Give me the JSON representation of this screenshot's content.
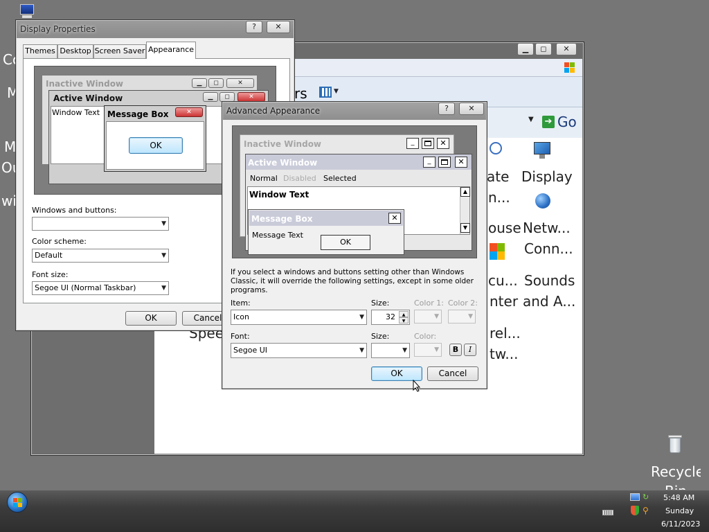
{
  "desktop": {
    "left_labels": [
      "Co",
      "M",
      "M",
      "Ou",
      "wi"
    ],
    "recycle_bin_label": "Recycle Bin"
  },
  "control_panel": {
    "toolbar_view_text": "rs",
    "go_label": "Go",
    "icons": [
      {
        "lines": [
          "ate",
          "n..."
        ],
        "icon": "update-icon"
      },
      {
        "lines": [
          "Display"
        ],
        "icon": "display-icon"
      },
      {
        "lines": [
          "ouse"
        ],
        "icon": "mouse-icon"
      },
      {
        "lines": [
          "Netw...",
          "Conn..."
        ],
        "icon": "network-icon"
      },
      {
        "lines": [
          "cu...",
          "nter"
        ],
        "icon": "security-icon"
      },
      {
        "lines": [
          "Sounds",
          "and A..."
        ],
        "icon": "sounds-icon"
      },
      {
        "lines": [
          "rel...",
          "tw..."
        ],
        "icon": "wireless-icon"
      },
      {
        "lines": [
          "Speech Sy"
        ],
        "icon": "speech-icon"
      }
    ]
  },
  "display_properties": {
    "title": "Display Properties",
    "help_btn": "?",
    "close_btn": "✕",
    "tabs": [
      "Themes",
      "Desktop",
      "Screen Saver",
      "Appearance"
    ],
    "active_tab": "Appearance",
    "preview": {
      "inactive_title": "Inactive Window",
      "active_title": "Active Window",
      "window_text": "Window Text",
      "msgbox_title": "Message Box",
      "msgbox_ok": "OK"
    },
    "windows_buttons_label": "Windows and buttons:",
    "windows_buttons_value": "",
    "color_scheme_label": "Color scheme:",
    "color_scheme_value": "Default",
    "font_size_label": "Font size:",
    "font_size_value": "Segoe UI (Normal Taskbar)",
    "ok": "OK",
    "cancel": "Cancel"
  },
  "advanced_appearance": {
    "title": "Advanced Appearance",
    "help_btn": "?",
    "close_btn": "✕",
    "preview": {
      "inactive_title": "Inactive Window",
      "active_title": "Active Window",
      "menu_normal": "Normal",
      "menu_disabled": "Disabled",
      "menu_selected": "Selected",
      "window_text": "Window Text",
      "msgbox_title": "Message Box",
      "msgbox_text": "Message Text",
      "msgbox_ok": "OK"
    },
    "info_text": "If you select a windows and buttons setting other than Windows Classic, it will override the following settings, except in some older programs.",
    "item_label": "Item:",
    "item_value": "Icon",
    "size_label": "Size:",
    "size_value": "32",
    "color1_label": "Color 1:",
    "color2_label": "Color 2:",
    "font_label": "Font:",
    "font_value": "Segoe UI",
    "font_size_label": "Size:",
    "font_size_value": "",
    "font_color_label": "Color:",
    "bold_btn": "B",
    "italic_btn": "I",
    "ok": "OK",
    "cancel": "Cancel"
  },
  "taskbar": {
    "time": "5:48 AM",
    "day": "Sunday",
    "date": "6/11/2023"
  },
  "colors": {
    "desktop": "#767676",
    "active_caption": "#c9cbd9",
    "inactive_caption": "#dcdcdc",
    "accent_link": "#1b5fa8",
    "default_button": "#bee6fd"
  }
}
